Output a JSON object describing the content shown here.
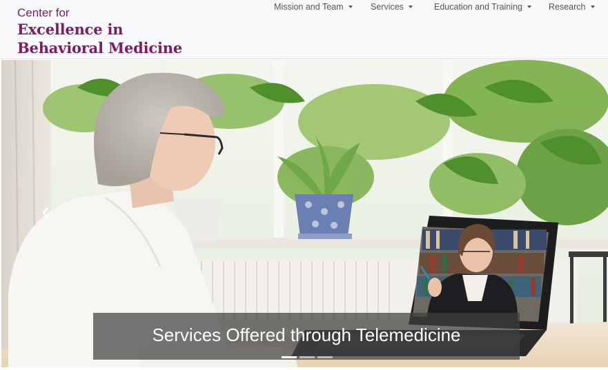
{
  "brand": {
    "line1": "Center for",
    "line2": "Excellence in",
    "line3": "Behavioral Medicine",
    "color": "#7b1c67"
  },
  "nav": {
    "items": [
      {
        "label": "Mission and Team"
      },
      {
        "label": "Services"
      },
      {
        "label": "Education and Training"
      },
      {
        "label": "Research"
      }
    ]
  },
  "carousel": {
    "caption": "Services Offered through Telemedicine",
    "prev_icon": "chevron-left-icon",
    "slide_count": 3,
    "active_slide": 1
  }
}
